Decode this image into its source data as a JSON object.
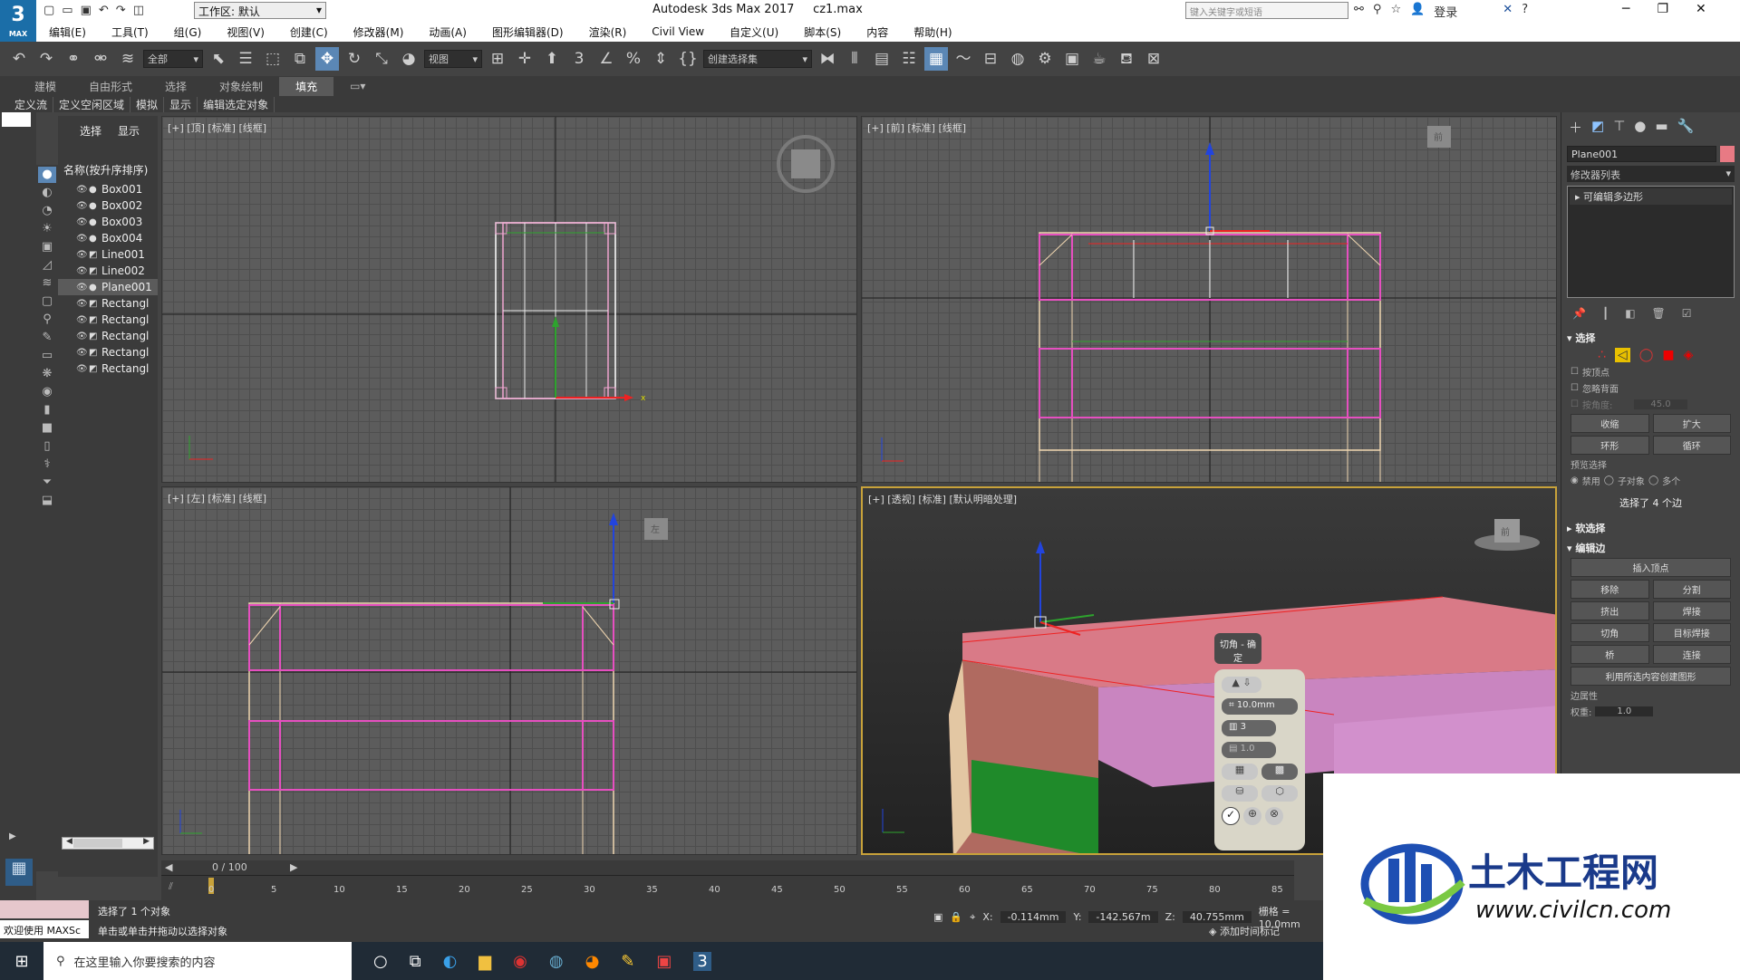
{
  "title_bar": {
    "app_title": "Autodesk 3ds Max 2017",
    "file_name": "cz1.max",
    "workspace_label": "工作区: 默认",
    "search_placeholder": "键入关键字或短语",
    "login_label": "登录",
    "logo_text": "3",
    "logo_sub": "MAX"
  },
  "menu": [
    "编辑(E)",
    "工具(T)",
    "组(G)",
    "视图(V)",
    "创建(C)",
    "修改器(M)",
    "动画(A)",
    "图形编辑器(D)",
    "渲染(R)",
    "Civil View",
    "自定义(U)",
    "脚本(S)",
    "内容",
    "帮助(H)"
  ],
  "toolbar": {
    "filter_value": "全部",
    "ref_coord_value": "视图",
    "selection_set_value": "创建选择集"
  },
  "ribbon": {
    "tabs": [
      "建模",
      "自由形式",
      "选择",
      "对象绘制",
      "填充"
    ],
    "active_tab": "填充",
    "sub_items": [
      "定义流",
      "定义空闲区域",
      "模拟",
      "显示",
      "编辑选定对象"
    ]
  },
  "explorer": {
    "tabs": [
      "选择",
      "显示"
    ],
    "sort_header": "名称(按升序排序)",
    "objects": [
      {
        "name": "Box001",
        "selected": false
      },
      {
        "name": "Box002",
        "selected": false
      },
      {
        "name": "Box003",
        "selected": false
      },
      {
        "name": "Box004",
        "selected": false
      },
      {
        "name": "Line001",
        "selected": false
      },
      {
        "name": "Line002",
        "selected": false
      },
      {
        "name": "Plane001",
        "selected": true
      },
      {
        "name": "Rectangl",
        "selected": false
      },
      {
        "name": "Rectangl",
        "selected": false
      },
      {
        "name": "Rectangl",
        "selected": false
      },
      {
        "name": "Rectangl",
        "selected": false
      },
      {
        "name": "Rectangl",
        "selected": false
      }
    ]
  },
  "viewports": {
    "top": "[+] [顶] [标准] [线框]",
    "front": "[+] [前] [标准] [线框]",
    "left": "[+] [左] [标准] [线框]",
    "persp": "[+] [透视] [标准] [默认明暗处理]",
    "viewcube_front": "前",
    "viewcube_left": "左",
    "viewcube_persp": "前"
  },
  "caddy": {
    "title": "切角 - 确定",
    "amount": "10.0mm",
    "segments": "3",
    "tension": "1.0"
  },
  "command_panel": {
    "object_name": "Plane001",
    "modifier_list": "修改器列表",
    "stack_item": "可编辑多边形",
    "selection_title": "选择",
    "by_vertex": "按顶点",
    "ignore_backfacing": "忽略背面",
    "by_angle": "按角度:",
    "angle_value": "45.0",
    "shrink": "收缩",
    "grow": "扩大",
    "ring": "环形",
    "loop": "循环",
    "preview_title": "预览选择",
    "preview_options": [
      "禁用",
      "子对象",
      "多个"
    ],
    "selection_info": "选择了 4 个边",
    "soft_selection": "软选择",
    "edit_edges": "编辑边",
    "insert_vertex": "插入顶点",
    "remove": "移除",
    "split": "分割",
    "extrude": "挤出",
    "weld": "焊接",
    "chamfer": "切角",
    "target_weld": "目标焊接",
    "bridge": "桥",
    "connect": "连接",
    "create_shape": "利用所选内容创建图形",
    "edge_props": "边属性",
    "weight_label": "权重:",
    "weight_value": "1.0"
  },
  "timeline": {
    "frame_label": "0 / 100",
    "ticks": [
      "0",
      "5",
      "10",
      "15",
      "20",
      "25",
      "30",
      "35",
      "40",
      "45",
      "50",
      "55",
      "60",
      "65",
      "70",
      "75",
      "80",
      "85"
    ]
  },
  "status": {
    "welcome": "欢迎使用 MAXSc",
    "selected": "选择了 1 个对象",
    "hint": "单击或单击并拖动以选择对象",
    "x_label": "X:",
    "x_value": "-0.114mm",
    "y_label": "Y:",
    "y_value": "-142.567m",
    "z_label": "Z:",
    "z_value": "40.755mm",
    "grid": "栅格 = 10.0mm",
    "add_time_tag": "添加时间标记"
  },
  "taskbar": {
    "search_placeholder": "在这里输入你要搜索的内容"
  },
  "watermark": {
    "title": "土木工程网",
    "url": "www.civilcn.com"
  }
}
